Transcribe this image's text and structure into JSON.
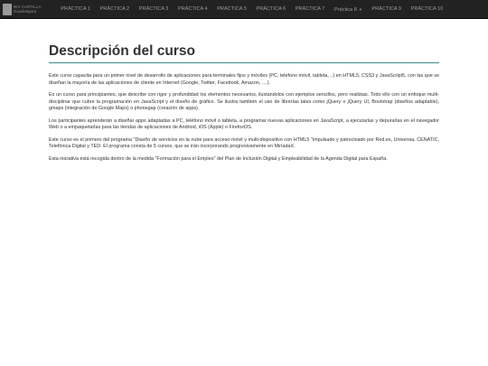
{
  "brand": {
    "line1": "IES CASTILLA",
    "line2": "Guadalajara"
  },
  "nav": {
    "items": [
      {
        "label": "PRÁCTICA 1"
      },
      {
        "label": "PRÁCTICA 2"
      },
      {
        "label": "PRÁCTICA 3"
      },
      {
        "label": "PRÁCTICA 4"
      },
      {
        "label": "PRÁCTICA 5"
      },
      {
        "label": "PRÁCTICA 6"
      },
      {
        "label": "PRÁCTICA 7"
      },
      {
        "label": "Práctica 8"
      },
      {
        "label": "PRÁCTICA 9"
      },
      {
        "label": "PRÁCTICA 10"
      }
    ]
  },
  "main": {
    "title": "Descripción del curso",
    "paragraphs": [
      "Este curso capacita para un primer nivel de desarrollo de aplicaciones para terminales fijos y móviles (PC, teléfono móvil, tableta, ..) en HTML5, CSS3 y JavaScript5, con las que se diseñan la mayoría de las aplicaciones de cliente en Internet (Google, Twitter, Facebook, Amazon, ....).",
      "Es un curso para principiantes, que describe con rigor y profundidad los elementos necesarios, ilustandolos con ejemplos sencillos, pero realistas. Todo ello con un enfoque multi-disciplinar que cubre la programación en JavaScript y el diseño de gráfico. Se ilustra también el uso de librerías tales como jQuery o jQuery UI, Bootstrap (diseños adaptable), gmaps (integración de Google Maps) o phonegap (creación de apps).",
      "Los participantes aprenderán a diseñar apps adaptadas a PC, teléfono móvil o tableta, a programar nuevas aplicaciones en JavaScript, a ejecutarlas y depurarlas en el navegador Web o a empaquetarlas para las tiendas de aplicaciones de Android, iOS (Apple) o FirefoxOS.",
      "Este curso es el primero del programa \"Diseño de servicios en la nube para acceso móvil y multi-dispositivo con HTML5 \"impulsado y patrocinado por Red.es, Universia, CENATIC, Telefónica Digital y TED. El programa consta de 5 cursos, que se irán incorporando progresivamente en MiríadaX.",
      "Esta iniciativa está recogida dentro de la medida \"Formación para el Empleo\" del Plan de Inclusión Digital y Empleabilidad de la Agenda Digital para España."
    ]
  }
}
